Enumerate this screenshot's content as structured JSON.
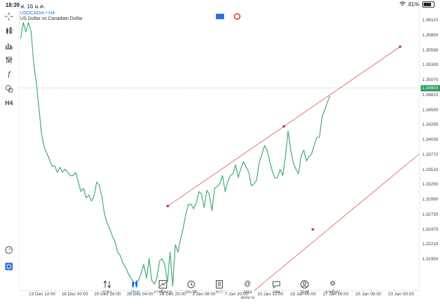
{
  "status_bar": {
    "time": "18:39",
    "date": "ส. 16 ม.ค.",
    "wifi": "wifi-icon",
    "battery": "81%"
  },
  "chart": {
    "symbol": "USDCADm • H4",
    "description": "US Dollar vs Canadian Dollar",
    "current_price": "1.34903"
  },
  "price_axis": [
    "1.36110",
    "1.35850",
    "1.35590",
    "1.35330",
    "1.35070",
    "1.34810",
    "1.34550",
    "1.34290",
    "1.34030",
    "1.33770",
    "1.33510",
    "1.33250",
    "1.32990",
    "1.32730",
    "1.32470",
    "1.32210",
    "1.31950"
  ],
  "time_axis": [
    "13 Dec 12:00",
    "18 Dec 00:00",
    "20 Dec 16:00",
    "26 Dec 04:00",
    "28 Dec 20:00",
    "3 Jan 08:00",
    "7 Jan 20:00",
    "10 Jan 12:00",
    "15 Jan 00:00",
    "17 Jan 16:00",
    "20 Jan 08:00",
    "23 Jan 00:00"
  ],
  "nav": [
    {
      "label": "ราคา",
      "icon": "sort-arrows-icon"
    },
    {
      "label": "กราฟ",
      "icon": "candles-icon"
    },
    {
      "label": "การซื้อขาย",
      "icon": "chart-line-icon"
    },
    {
      "label": "ประวัติ",
      "icon": "history-icon"
    },
    {
      "label": "ข่าว",
      "icon": "news-icon"
    },
    {
      "label": "กล่องจดหมาย",
      "icon": "at-icon"
    },
    {
      "label": "แชท",
      "icon": "chat-icon"
    },
    {
      "label": "บัญชี",
      "icon": "account-icon"
    },
    {
      "label": "การตั้งค่า",
      "icon": "gear-icon"
    }
  ],
  "toolbar": [
    "crosshair-icon",
    "candles-icon",
    "bars-icon",
    "indicators-icon",
    "function-icon",
    "shapes-icon",
    "timeframe-h4-icon"
  ],
  "toolbar_h4": "H4",
  "colors": {
    "price_line": "#4fb07b",
    "channel": "#e0554f",
    "accent": "#1a73e8"
  },
  "chart_data": {
    "type": "line",
    "series": [
      {
        "values": [
          1.358,
          1.3605,
          1.359,
          1.3605,
          1.359,
          1.354,
          1.351,
          1.347,
          1.343,
          1.341,
          1.34,
          1.339,
          1.338,
          1.338,
          1.337,
          1.3378,
          1.337,
          1.3375,
          1.337,
          1.3365,
          1.3365,
          1.337,
          1.3355,
          1.334,
          1.3345,
          1.333,
          1.3335,
          1.3325,
          1.3333,
          1.3355,
          1.335,
          1.3332,
          1.3305,
          1.329,
          1.3282,
          1.327,
          1.3262,
          1.3245,
          1.324,
          1.3228,
          1.3222,
          1.3212,
          1.3205,
          1.3198,
          1.3196,
          1.3201,
          1.3212,
          1.3226,
          1.3204,
          1.3235,
          1.3201,
          1.3195,
          1.3205,
          1.3231,
          1.3235,
          1.3225,
          1.3198,
          1.3245,
          1.3192,
          1.3257,
          1.3245,
          1.3265,
          1.3282,
          1.3305,
          1.332,
          1.332,
          1.3313,
          1.3322,
          1.334,
          1.3336,
          1.3315,
          1.3342,
          1.3335,
          1.331,
          1.3345,
          1.3348,
          1.3352,
          1.3365,
          1.334,
          1.3356,
          1.3365,
          1.3368,
          1.3382,
          1.3362,
          1.3376,
          1.3387,
          1.3378,
          1.3371,
          1.3349,
          1.3352,
          1.3358,
          1.3385,
          1.3398,
          1.3412,
          1.3405,
          1.3387,
          1.3372,
          1.3361,
          1.3362,
          1.3375,
          1.3365,
          1.3395,
          1.3435,
          1.3405,
          1.3385,
          1.3375,
          1.3368,
          1.3396,
          1.3405,
          1.3388,
          1.3395,
          1.3399,
          1.3413,
          1.3425,
          1.3425,
          1.3458,
          1.3468,
          1.348,
          1.349
        ]
      }
    ],
    "xlabels": [
      "13 Dec 12:00",
      "18 Dec 00:00",
      "20 Dec 16:00",
      "26 Dec 04:00",
      "28 Dec 20:00",
      "3 Jan 08:00",
      "7 Jan 20:00",
      "10 Jan 12:00",
      "15 Jan 00:00",
      "17 Jan 16:00",
      "20 Jan 08:00",
      "23 Jan 00:00"
    ],
    "ylim": [
      1.3185,
      1.3625
    ]
  }
}
